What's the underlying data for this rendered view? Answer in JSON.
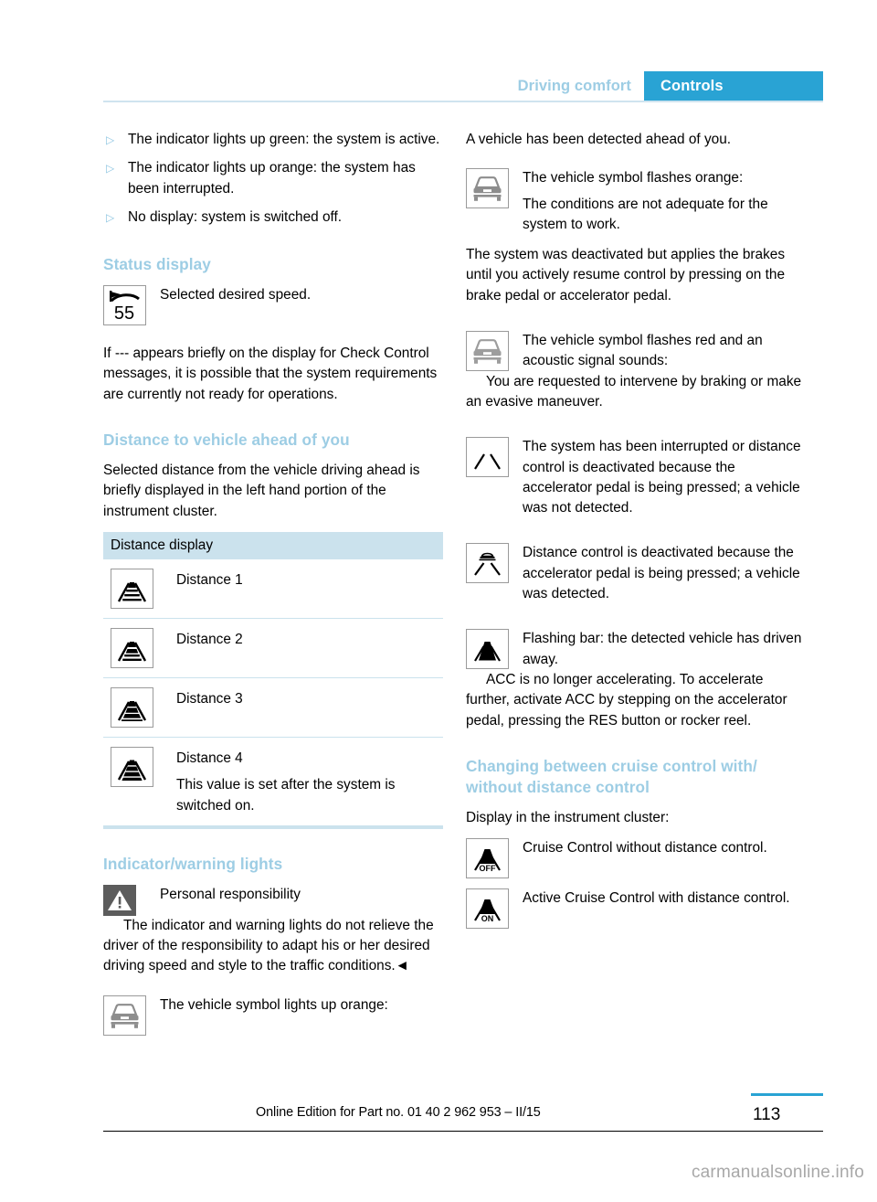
{
  "header": {
    "chapter": "Driving comfort",
    "section": "Controls"
  },
  "left_column": {
    "bullets": [
      {
        "mark": "▷",
        "text": "The indicator lights up green: the system is active."
      },
      {
        "mark": "▷",
        "text": "The indicator lights up orange: the system has been interrupted."
      },
      {
        "mark": "▷",
        "text": "No display: system is switched off."
      }
    ],
    "status_display": {
      "heading": "Status display",
      "icon_name": "desired-speed-55-icon",
      "icon_value": "55",
      "caption": "Selected desired speed.",
      "paragraph": "If --- appears briefly on the display for Check Control messages, it is possible that the system requirements are currently not ready for operations."
    },
    "distance_section": {
      "heading": "Distance to vehicle ahead of you",
      "paragraph": "Selected distance from the vehicle driving ahead is briefly displayed in the left hand portion of the instrument cluster.",
      "table_header": "Distance display",
      "rows": [
        {
          "icon_name": "distance-1-icon",
          "label": "Distance 1",
          "note": ""
        },
        {
          "icon_name": "distance-2-icon",
          "label": "Distance 2",
          "note": ""
        },
        {
          "icon_name": "distance-3-icon",
          "label": "Distance 3",
          "note": ""
        },
        {
          "icon_name": "distance-4-icon",
          "label": "Distance 4",
          "note": "This value is set after the system is switched on."
        }
      ]
    },
    "indicator_section": {
      "heading": "Indicator/warning lights",
      "warning_icon_name": "warning-triangle-icon",
      "warning_title": "Personal responsibility",
      "warning_text": "The indicator and warning lights do not relieve the driver of the responsibility to adapt his or her desired driving speed and style to the traffic conditions.◄",
      "vehicle_icon_name": "vehicle-front-orange-icon",
      "vehicle_text": "The vehicle symbol lights up orange:"
    }
  },
  "right_column": {
    "intro": "A vehicle has been detected ahead of you.",
    "blocks": [
      {
        "icon_name": "vehicle-front-flash-orange-icon",
        "title": "The vehicle symbol flashes orange:",
        "body": "The conditions are not adequate for the system to work.",
        "runon": "The system was deactivated but applies the brakes until you actively resume control by pressing on the brake pedal or accelerator pedal."
      },
      {
        "icon_name": "vehicle-front-flash-red-icon",
        "title": "The vehicle symbol flashes red and an acoustic signal sounds:",
        "body": "You are requested to intervene by braking or make an evasive maneuver.",
        "runon": ""
      },
      {
        "icon_name": "lane-only-icon",
        "title": "The system has been interrupted or distance control is deactivated because the accelerator pedal is being pressed; a vehicle was not detected.",
        "body": "",
        "runon": ""
      },
      {
        "icon_name": "lane-with-vehicle-icon",
        "title": "Distance control is deactivated because the accelerator pedal is being pressed; a vehicle was detected.",
        "body": "",
        "runon": ""
      },
      {
        "icon_name": "flashing-bar-icon",
        "title": "Flashing bar: the detected vehicle has driven away.",
        "body": "ACC is no longer accelerating. To accelerate further, activate ACC by stepping on the accelerator pedal, pressing the RES button or rocker reel.",
        "runon": ""
      }
    ],
    "changing_section": {
      "heading": "Changing between cruise control with/ without distance control",
      "paragraph": "Display in the instrument cluster:",
      "items": [
        {
          "icon_name": "cruise-control-off-icon",
          "icon_label": "OFF",
          "text": "Cruise Control without distance control."
        },
        {
          "icon_name": "cruise-control-on-icon",
          "icon_label": "ON",
          "text": "Active Cruise Control with distance control."
        }
      ]
    }
  },
  "footer": {
    "edition": "Online Edition for Part no. 01 40 2 962 953 – II/15",
    "page_number": "113",
    "watermark": "carmanualsonline.info"
  },
  "colors": {
    "accent": "#29a3d4",
    "heading": "#9dcde4",
    "table_header_bg": "#cbe2ed",
    "rule": "#cfe4ef"
  }
}
